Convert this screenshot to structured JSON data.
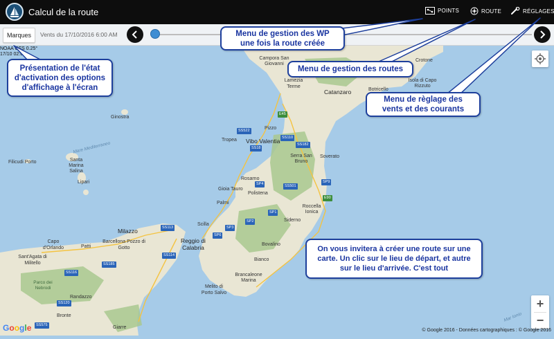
{
  "app": {
    "title": "Calcul de la route"
  },
  "toolbar": {
    "points_label": "POINTS",
    "route_label": "ROUTE",
    "settings_label": "RÉGLAGES"
  },
  "subbar": {
    "marques_label": "Marques",
    "winds_label": "Vents du 17/10/2016 6:00 AM"
  },
  "noaa": {
    "text": "NOAA GFS 0.25°\n17/10 02:00"
  },
  "callouts": {
    "wp_menu": [
      "Menu de gestion des WP",
      "une fois la route créée"
    ],
    "route_menu": [
      "Menu de gestion des routes"
    ],
    "settings_menu": [
      "Menu de règlage des",
      "vents et des courants"
    ],
    "presentation": [
      "Présentation de l'état",
      "d'activation des options",
      "d'affichage à l'écran"
    ],
    "invite": [
      "On vous invitera à créer une route sur une",
      "carte. Un clic sur le lieu de départ, et autre",
      "sur le lieu d'arrivée. C'est tout"
    ]
  },
  "map": {
    "places": [
      {
        "id": "crotone",
        "name": "Crotone"
      },
      {
        "id": "campora",
        "name": "Campora San Giovanni"
      },
      {
        "id": "lamezia",
        "name": "Lamezia Terme"
      },
      {
        "id": "catanzaro",
        "name": "Catanzaro",
        "big": true
      },
      {
        "id": "botricello",
        "name": "Botricello"
      },
      {
        "id": "isola",
        "name": "Isola di Capo Rizzuto"
      },
      {
        "id": "ginostra",
        "name": "Ginostra"
      },
      {
        "id": "pizzo",
        "name": "Pizzo"
      },
      {
        "id": "tropea",
        "name": "Tropea"
      },
      {
        "id": "vibo",
        "name": "Vibo Valentia"
      },
      {
        "id": "soverato",
        "name": "Soverato"
      },
      {
        "id": "serra",
        "name": "Serra San Bruno"
      },
      {
        "id": "filicudi",
        "name": "Filicudi Porto"
      },
      {
        "id": "santamarina",
        "name": "Santa Marina Salina"
      },
      {
        "id": "lipari",
        "name": "Lipari"
      },
      {
        "id": "rosarno",
        "name": "Rosarno"
      },
      {
        "id": "gioia",
        "name": "Gioia Tauro"
      },
      {
        "id": "polistena",
        "name": "Polistena"
      },
      {
        "id": "palmi",
        "name": "Palmi"
      },
      {
        "id": "roccella",
        "name": "Roccella Ionica"
      },
      {
        "id": "siderno",
        "name": "Siderno"
      },
      {
        "id": "milazzo",
        "name": "Milazzo"
      },
      {
        "id": "scilla",
        "name": "Scilla"
      },
      {
        "id": "barcellona",
        "name": "Barcellona Pozzo di Gotto"
      },
      {
        "id": "capo",
        "name": "Capo d'Orlando"
      },
      {
        "id": "patti",
        "name": "Patti"
      },
      {
        "id": "reggio",
        "name": "Reggio di Calabria"
      },
      {
        "id": "santagata",
        "name": "Sant'Agata di Militello"
      },
      {
        "id": "bovalino",
        "name": "Bovalino"
      },
      {
        "id": "bianco",
        "name": "Bianco"
      },
      {
        "id": "randazzo",
        "name": "Randazzo"
      },
      {
        "id": "bronte",
        "name": "Bronte"
      },
      {
        "id": "brancaleone",
        "name": "Brancaleone Marina"
      },
      {
        "id": "melito",
        "name": "Melito di Porto Salvo"
      },
      {
        "id": "giarre",
        "name": "Giarre"
      },
      {
        "id": "nebrodi",
        "name": "Parco dei Nebrodi",
        "park": true
      },
      {
        "id": "tirreno",
        "name": "Mare Mediterraneo",
        "sea": true
      },
      {
        "id": "ionio",
        "name": "Mar Ionio",
        "sea": true
      }
    ],
    "roads": [
      {
        "id": "ss522",
        "label": "SS522"
      },
      {
        "id": "ss110",
        "label": "SS110"
      },
      {
        "id": "ss18",
        "label": "SS18"
      },
      {
        "id": "ss182",
        "label": "SS182"
      },
      {
        "id": "sp4",
        "label": "SP4"
      },
      {
        "id": "ss501",
        "label": "SS501"
      },
      {
        "id": "sp9",
        "label": "SP9"
      },
      {
        "id": "e90",
        "label": "E90",
        "green": true
      },
      {
        "id": "sp1",
        "label": "SP1"
      },
      {
        "id": "ss113",
        "label": "SS113"
      },
      {
        "id": "sp2",
        "label": "SP2"
      },
      {
        "id": "sp3",
        "label": "SP3"
      },
      {
        "id": "sp6",
        "label": "SP6"
      },
      {
        "id": "ss114",
        "label": "SS114"
      },
      {
        "id": "ss185",
        "label": "SS185"
      },
      {
        "id": "ss116",
        "label": "SS116"
      },
      {
        "id": "ss120",
        "label": "SS120"
      },
      {
        "id": "ss575",
        "label": "SS575"
      },
      {
        "id": "e45",
        "label": "E45",
        "green": true
      }
    ],
    "google_logo": "Google",
    "copyright": "© Google 2016 - Données cartographiques : © Google 2016",
    "zoom_in": "+",
    "zoom_out": "−"
  },
  "colors": {
    "callout_border": "#1d3f9c",
    "callout_text": "#1a35a0",
    "sea": "#a6cbe8",
    "land": "#e9e6d4",
    "forest": "#a9c88f"
  },
  "icons": {
    "logo": "sailboat-logo-icon",
    "points": "map-points-icon",
    "route": "compass-rose-icon",
    "settings": "wrench-icon",
    "prev": "chevron-left-icon",
    "next": "chevron-right-icon",
    "locate": "my-location-icon"
  }
}
